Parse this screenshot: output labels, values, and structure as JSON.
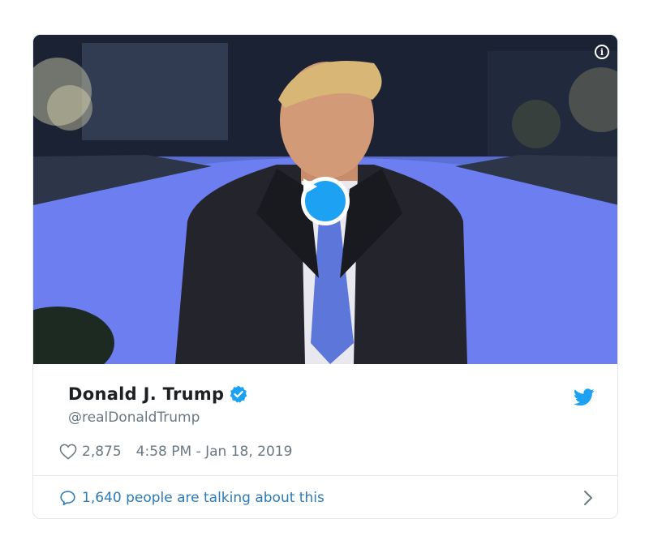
{
  "tweet": {
    "display_name": "Donald J. Trump",
    "handle": "@realDonaldTrump",
    "likes": "2,875",
    "timestamp": "4:58 PM - Jan 18, 2019",
    "conversation_text": "1,640 people are talking about this"
  },
  "media": {
    "info_icon": "i",
    "play_icon": "play-icon"
  },
  "colors": {
    "accent": "#1da1f2",
    "link": "#2b7bb9",
    "muted": "#697882",
    "border": "#e1e8ed"
  }
}
